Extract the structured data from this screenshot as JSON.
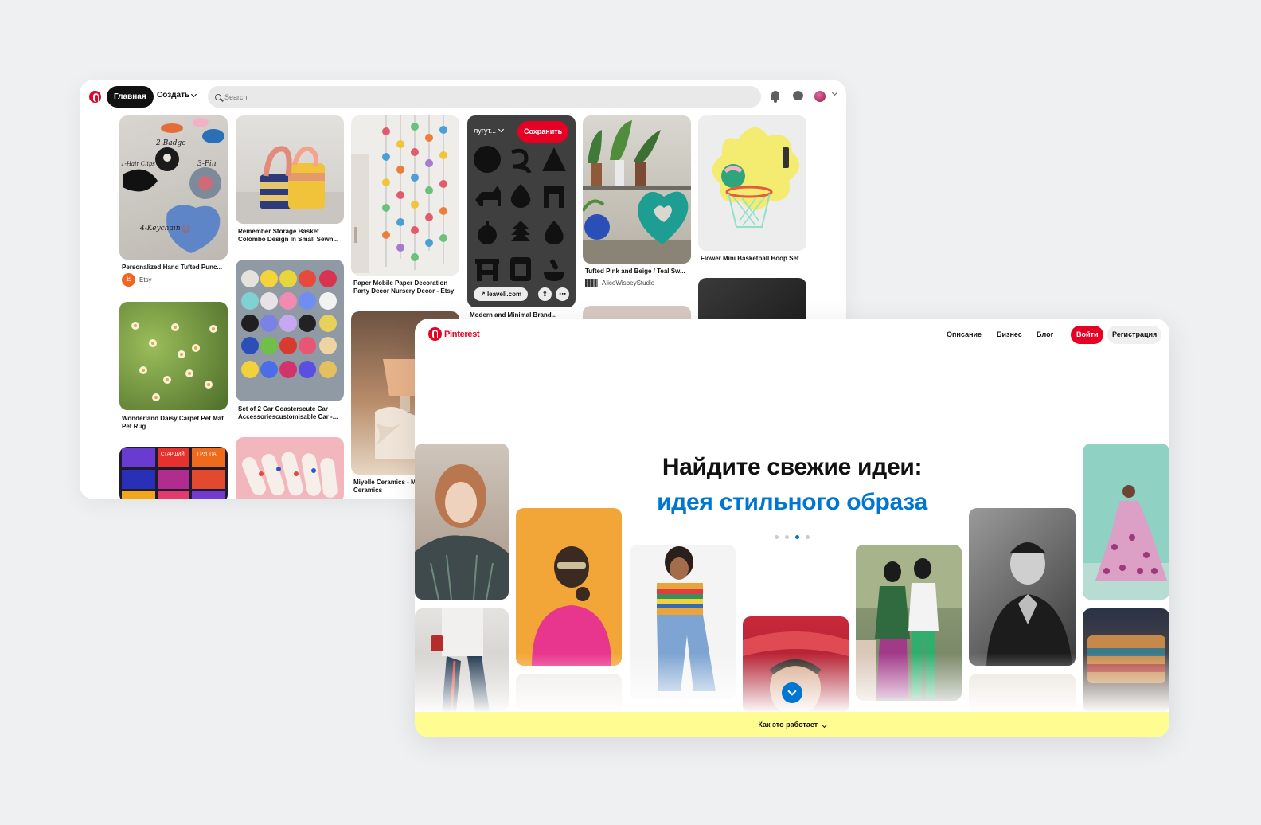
{
  "feed": {
    "nav": {
      "home_label": "Главная",
      "create_label": "Создать",
      "search_placeholder": "Search"
    },
    "pins": [
      {
        "title": "Personalized Hand Tufted Punc...",
        "source": "Etsy"
      },
      {
        "title": "Remember Storage Basket Colombo Design In Small Sewn..."
      },
      {
        "title": "Paper Mobile Paper Decoration Party Decor Nursery Decor - Etsy"
      },
      {
        "title": "Modern and Minimal Brand...",
        "board": "лугут...",
        "save_label": "Сохранить",
        "link": "leaveli.com"
      },
      {
        "title": "Tufted Pink and Beige / Teal Sw...",
        "source": "AliceWisbeyStudio"
      },
      {
        "title": "Flower Mini Basketball Hoop Set"
      },
      {
        "title": "Wonderland Daisy Carpet Pet Mat Pet Rug"
      },
      {
        "title": "Set of 2 Car Coasterscute Car Accessoriescustomisable Car -..."
      },
      {
        "title": "Miyelle Ceramics - M Minimalist Ceramics"
      }
    ],
    "image_text": {
      "badge": "2-Badge",
      "hair": "1-Hair Clips",
      "pin": "3-Pin",
      "keychain": "4-Keychain",
      "etsy_letter": "E",
      "poster_1": "СТАРШИЙ",
      "poster_2": "ГРУППА"
    }
  },
  "landing": {
    "brand": "Pinterest",
    "nav": {
      "about": "Описание",
      "business": "Бизнес",
      "blog": "Блог",
      "login": "Войти",
      "signup": "Регистрация"
    },
    "hero_line1": "Найдите свежие идеи:",
    "hero_line2": "идея стильного образа",
    "carousel_active": 3,
    "carousel_total": 4,
    "footer_label": "Как это работает"
  },
  "colors": {
    "brand_red": "#e60023",
    "accent_blue": "#0076d3",
    "footer_yellow": "#fffd92",
    "background": "#eff0f2"
  }
}
